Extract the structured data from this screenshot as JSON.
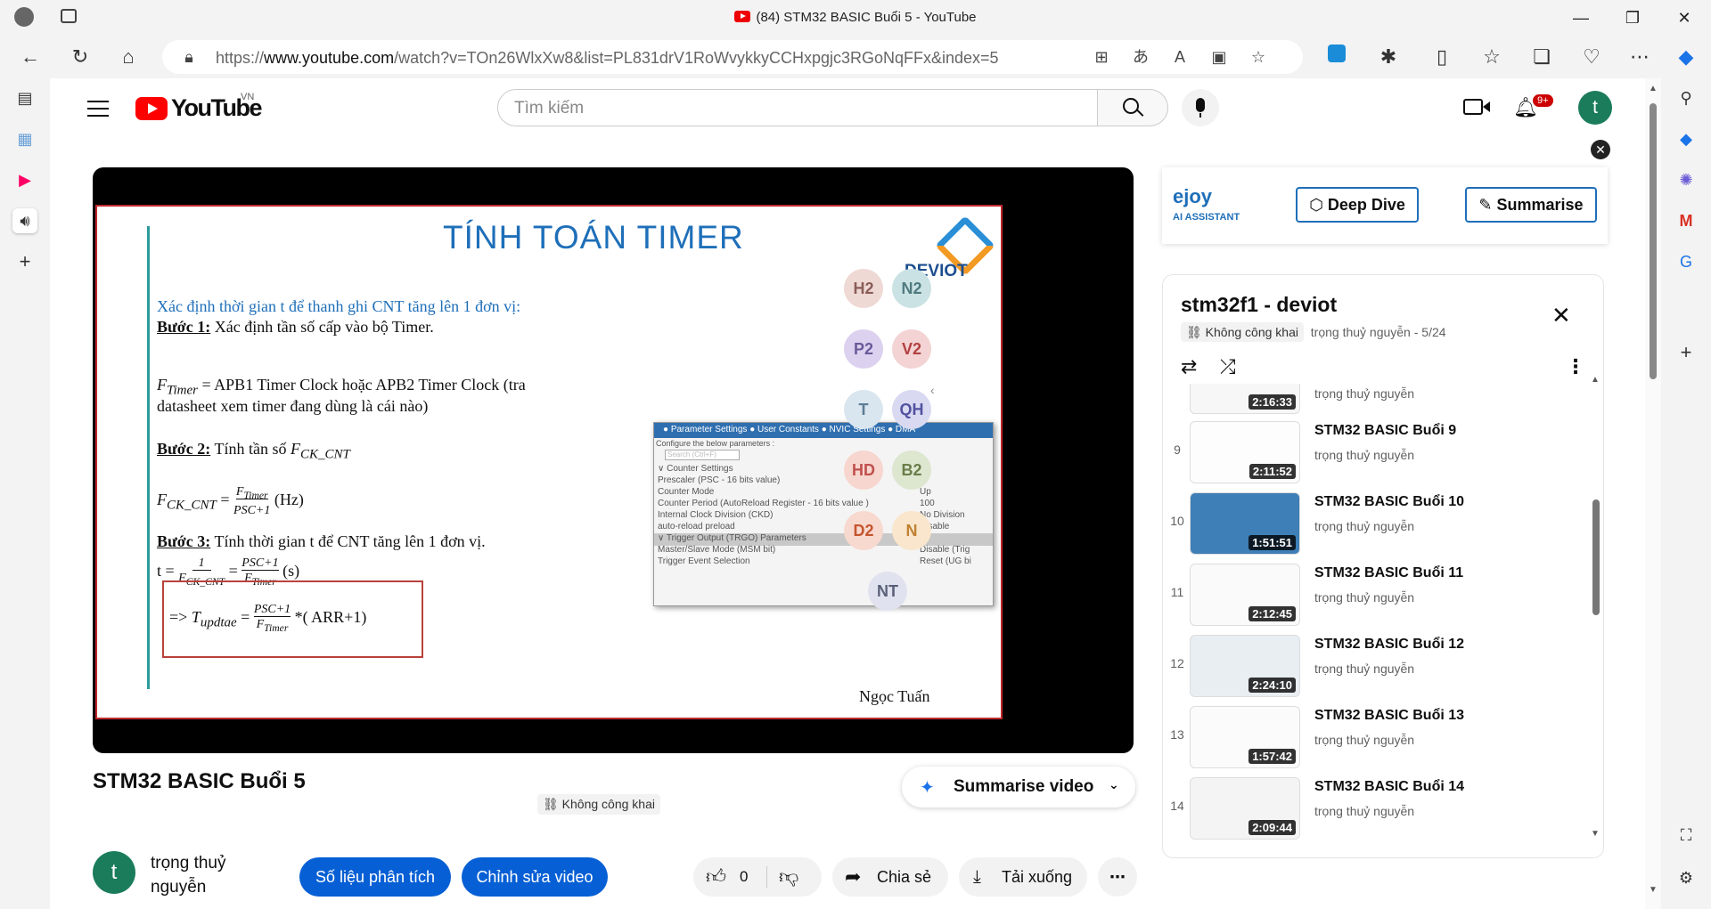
{
  "window": {
    "title": "(84) STM32 BASIC Buổi 5 - YouTube",
    "minimize": "—",
    "maximize": "❐",
    "close": "✕"
  },
  "browser": {
    "url_prefix": "https://",
    "url_domain": "www.youtube.com",
    "url_path": "/watch?v=TOn26WlxXw8&list=PL831drV1RoWvykkyCCHxpgjc3RGoNqFFx&index=5"
  },
  "youtube": {
    "logo_text": "YouTube",
    "region": "VN",
    "search_placeholder": "Tìm kiếm",
    "notification_count": "9+",
    "avatar_letter": "t"
  },
  "video": {
    "slide": {
      "title": "TÍNH TOÁN TIMER",
      "subtitle": "Xác định thời gian t để thanh ghi CNT tăng lên 1 đơn vị:",
      "step1_label": "Bước 1:",
      "step1_text": "Xác định tần số cấp vào bộ Timer.",
      "ftimer_line1": "= APB1 Timer Clock hoặc APB2 Timer Clock (tra",
      "ftimer_line2": "datasheet xem timer đang dùng là cái nào)",
      "step2_label": "Bước 2:",
      "step2_text": "Tính tần số",
      "hz": "(Hz)",
      "step3_label": "Bước 3:",
      "step3_text": "Tính thời gian t để CNT tăng lên 1 đơn vị.",
      "seconds": "(s)",
      "result_tail": "*( ARR+1)",
      "logo": "DEVIOT",
      "author": "Ngọc Tuấn"
    },
    "cubemx": {
      "tabs": "● Parameter Settings   ● User Constants   ● NVIC Settings   ● DMA",
      "configure": "Configure the below parameters :",
      "search": "Search (Ctrl+F)",
      "rows": [
        {
          "k": "∨ Counter Settings",
          "v": ""
        },
        {
          "k": "      Prescaler (PSC - 16 bits value)",
          "v": "0"
        },
        {
          "k": "      Counter Mode",
          "v": "Up"
        },
        {
          "k": "      Counter Period (AutoReload Register - 16 bits value )",
          "v": "100"
        },
        {
          "k": "      Internal Clock Division (CKD)",
          "v": "No Division"
        },
        {
          "k": "      auto-reload preload",
          "v": "Disable"
        },
        {
          "k": "∨ Trigger Output (TRGO) Parameters",
          "v": ""
        },
        {
          "k": "      Master/Slave Mode (MSM bit)",
          "v": "Disable (Trig"
        },
        {
          "k": "      Trigger Event Selection",
          "v": "Reset (UG bi"
        }
      ]
    },
    "participants": [
      "H2",
      "N2",
      "P2",
      "V2",
      "T",
      "QH",
      "HD",
      "B2",
      "D2",
      "N",
      "NT"
    ]
  },
  "watch": {
    "title": "STM32 BASIC Buổi 5",
    "visibility": "Không công khai",
    "summarise": "Summarise video",
    "channel_avatar": "t",
    "channel_line1": "trọng thuỷ",
    "channel_line2": "nguyễn",
    "analytics_btn": "Số liệu phân tích",
    "edit_btn": "Chỉnh sửa video",
    "likes": "0",
    "share": "Chia sẻ",
    "download": "Tải xuống"
  },
  "ejoy": {
    "brand": "ejoy",
    "brand_sub": "AI ASSISTANT",
    "deep_dive": "Deep Dive",
    "summarise": "Summarise"
  },
  "playlist": {
    "title": "stm32f1 - deviot",
    "visibility": "Không công khai",
    "owner_progress": "trọng thuỷ nguyễn - 5/24",
    "partial_duration": "2:16:33",
    "partial_channel": "trọng thuỷ nguyễn",
    "items": [
      {
        "index": "9",
        "title": "STM32 BASIC Buổi 9",
        "channel": "trọng thuỷ nguyễn",
        "duration": "2:11:52"
      },
      {
        "index": "10",
        "title": "STM32 BASIC Buổi 10",
        "channel": "trọng thuỷ nguyễn",
        "duration": "1:51:51"
      },
      {
        "index": "11",
        "title": "STM32 BASIC Buổi 11",
        "channel": "trọng thuỷ nguyễn",
        "duration": "2:12:45"
      },
      {
        "index": "12",
        "title": "STM32 BASIC Buổi 12",
        "channel": "trọng thuỷ nguyễn",
        "duration": "2:24:10"
      },
      {
        "index": "13",
        "title": "STM32 BASIC Buổi 13",
        "channel": "trọng thuỷ nguyễn",
        "duration": "1:57:42"
      },
      {
        "index": "14",
        "title": "STM32 BASIC Buổi 14",
        "channel": "trọng thuỷ nguyễn",
        "duration": "2:09:44"
      }
    ]
  }
}
